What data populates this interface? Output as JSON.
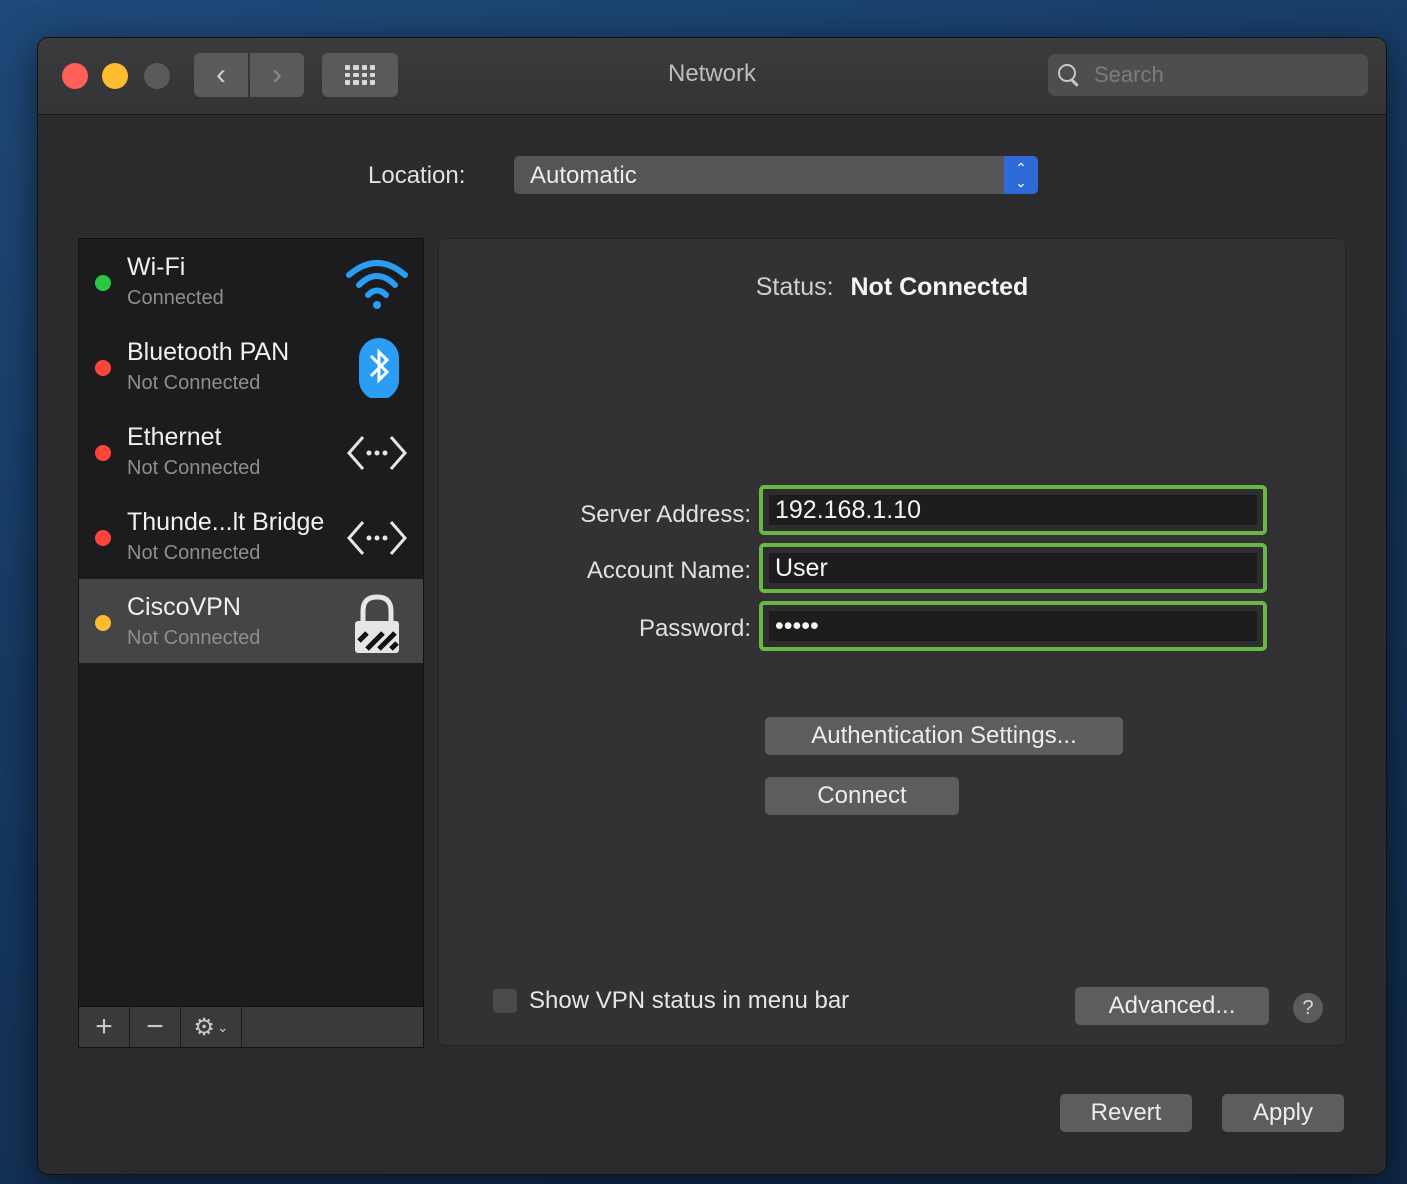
{
  "window": {
    "title": "Network",
    "search_placeholder": "Search",
    "nav": {
      "back": "‹",
      "forward": "›"
    }
  },
  "location": {
    "label": "Location:",
    "value": "Automatic"
  },
  "services": [
    {
      "name": "Wi-Fi",
      "status": "Connected",
      "dot_color": "#28c840",
      "icon": "wifi-icon"
    },
    {
      "name": "Bluetooth PAN",
      "status": "Not Connected",
      "dot_color": "#ff453a",
      "icon": "bluetooth-icon"
    },
    {
      "name": "Ethernet",
      "status": "Not Connected",
      "dot_color": "#ff453a",
      "icon": "ethernet-icon"
    },
    {
      "name": "Thunde...lt Bridge",
      "status": "Not Connected",
      "dot_color": "#ff453a",
      "icon": "thunderbolt-bridge-icon"
    },
    {
      "name": "CiscoVPN",
      "status": "Not Connected",
      "dot_color": "#febc2e",
      "icon": "vpn-lock-icon",
      "selected": true
    }
  ],
  "sidebar_toolbar": {
    "add": "+",
    "remove": "−",
    "gear": "⚙"
  },
  "detail": {
    "status_label": "Status:",
    "status_value": "Not Connected",
    "server_address": {
      "label": "Server Address:",
      "value": "192.168.1.10"
    },
    "account_name": {
      "label": "Account Name:",
      "value": "User"
    },
    "password": {
      "label": "Password:",
      "value": "•••••"
    },
    "auth_button": "Authentication Settings...",
    "connect_button": "Connect",
    "show_vpn_label": "Show VPN status in menu bar",
    "advanced_button": "Advanced...",
    "help": "?"
  },
  "footer": {
    "revert": "Revert",
    "apply": "Apply"
  },
  "colors": {
    "highlight_border": "#6ab745",
    "stepper_blue": "#2f6bd8"
  }
}
